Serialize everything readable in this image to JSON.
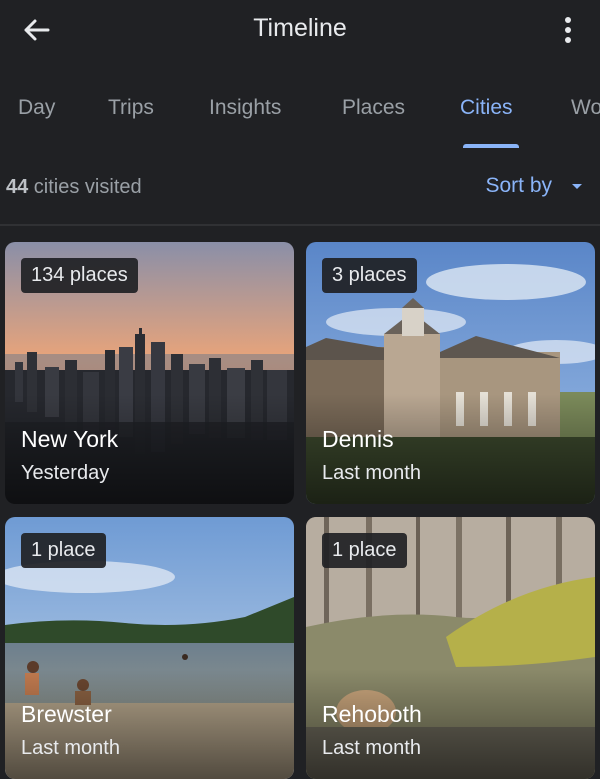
{
  "header": {
    "title": "Timeline"
  },
  "tabs": [
    {
      "label": "Day"
    },
    {
      "label": "Trips"
    },
    {
      "label": "Insights"
    },
    {
      "label": "Places"
    },
    {
      "label": "Cities",
      "active": true
    },
    {
      "label": "Wo"
    }
  ],
  "summary": {
    "count": "44",
    "text": " cities visited"
  },
  "sort": {
    "label": "Sort by"
  },
  "cards": [
    {
      "badge": "134 places",
      "city": "New York",
      "when": "Yesterday"
    },
    {
      "badge": "3 places",
      "city": "Dennis",
      "when": "Last month"
    },
    {
      "badge": "1 place",
      "city": "Brewster",
      "when": "Last month"
    },
    {
      "badge": "1 place",
      "city": "Rehoboth",
      "when": "Last month"
    }
  ],
  "colors": {
    "background": "#202124",
    "accent": "#8ab4f8",
    "muted_text": "#9aa0a6"
  },
  "icons": {
    "back": "arrow-left-icon",
    "more": "more-vert-icon",
    "sort": "caret-down-icon"
  }
}
